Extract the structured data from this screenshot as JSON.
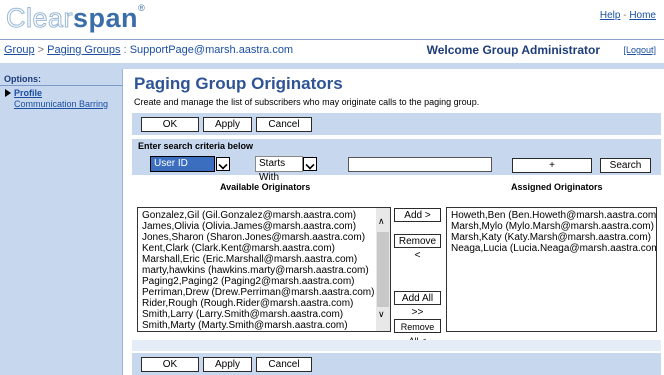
{
  "header": {
    "logo_part1": "Clear",
    "logo_part2": "span",
    "logo_tm": "®",
    "help_link": "Help",
    "home_link": "Home",
    "link_sep": " - "
  },
  "breadcrumb": {
    "group": "Group",
    "sep1": " > ",
    "paging_groups": "Paging Groups",
    "sep2": " : ",
    "current": "SupportPage@marsh.aastra.com"
  },
  "welcome": "Welcome Group Administrator",
  "logout": "[Logout]",
  "sidebar": {
    "title": "Options:",
    "items": [
      {
        "label": "Profile"
      },
      {
        "label": "Communication Barring"
      }
    ]
  },
  "page": {
    "title": "Paging Group Originators",
    "description": "Create and manage the list of subscribers who may originate calls to the paging group."
  },
  "buttons": {
    "ok": "OK",
    "apply": "Apply",
    "cancel": "Cancel"
  },
  "search": {
    "label": "Enter search criteria below",
    "field_select": "User ID",
    "mode_select": "Starts With",
    "input_value": "",
    "plus": "+",
    "search_button": "Search"
  },
  "available": {
    "heading": "Available Originators",
    "items": [
      "Gonzalez,Gil (Gil.Gonzalez@marsh.aastra.com)",
      "James,Olivia (Olivia.James@marsh.aastra.com)",
      "Jones,Sharon (Sharon.Jones@marsh.aastra.com)",
      "Kent,Clark (Clark.Kent@marsh.aastra.com)",
      "Marshall,Eric (Eric.Marshall@marsh.aastra.com)",
      "marty,hawkins (hawkins.marty@marsh.aastra.com)",
      "Paging2,Paging2 (Paging2@marsh.aastra.com)",
      "Perriman,Drew (Drew.Perriman@marsh.aastra.com)",
      "Rider,Rough (Rough.Rider@marsh.aastra.com)",
      "Smith,Larry (Larry.Smith@marsh.aastra.com)",
      "Smith,Marty (Marty.Smith@marsh.aastra.com)"
    ]
  },
  "transfer": {
    "add": "Add >",
    "remove": "Remove <",
    "add_all": "Add All >>",
    "remove_all": "Remove All <"
  },
  "assigned": {
    "heading": "Assigned Originators",
    "items": [
      "Howeth,Ben (Ben.Howeth@marsh.aastra.com)",
      "Marsh,Mylo (Mylo.Marsh@marsh.aastra.com)",
      "Marsh,Katy (Katy.Marsh@marsh.aastra.com)",
      "Neaga,Lucia (Lucia.Neaga@marsh.aastra.com)"
    ]
  },
  "colors": {
    "accent_blue": "#2f5496",
    "band_blue": "#c7d7ee",
    "link_blue": "#1a4fa3"
  }
}
